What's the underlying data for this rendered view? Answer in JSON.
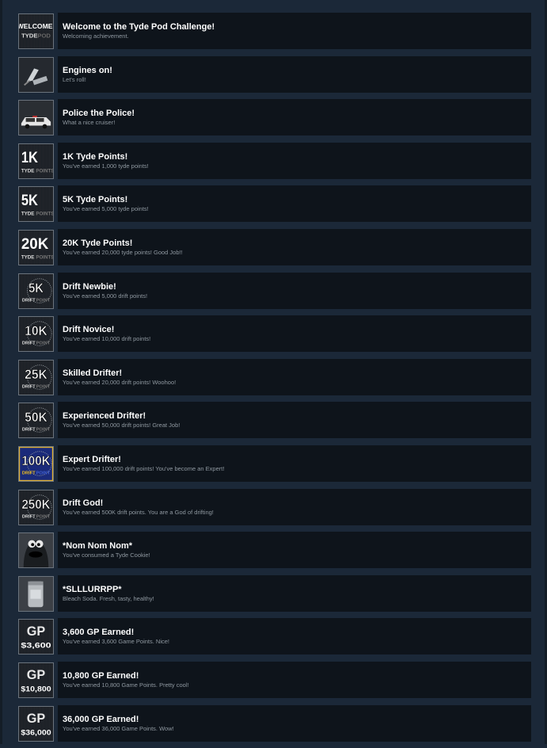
{
  "achievements": [
    {
      "title": "Welcome to the Tyde Pod Challenge!",
      "description": "Welcoming achievement.",
      "icon": "welcome-icon",
      "icon_line1": "WELCOME!",
      "icon_line2": "TYDE",
      "icon_line2b": "POD"
    },
    {
      "title": "Engines on!",
      "description": "Let's roll!",
      "icon": "car-seat-icon"
    },
    {
      "title": "Police the Police!",
      "description": "What a nice cruiser!",
      "icon": "police-car-icon"
    },
    {
      "title": "1K Tyde Points!",
      "description": "You've earned 1,000 tyde points!",
      "icon": "tyde-points-icon",
      "icon_line1": "1K",
      "icon_line2": "TYDE",
      "icon_line2b": "POINTS"
    },
    {
      "title": "5K Tyde Points!",
      "description": "You've earned 5,000 tyde points!",
      "icon": "tyde-points-icon",
      "icon_line1": "5K",
      "icon_line2": "TYDE",
      "icon_line2b": "POINTS"
    },
    {
      "title": "20K Tyde Points!",
      "description": "You've earned 20,000 tyde points! Good Job!!",
      "icon": "tyde-points-icon",
      "icon_line1": "20K",
      "icon_line2": "TYDE",
      "icon_line2b": "POINTS"
    },
    {
      "title": "Drift Newbie!",
      "description": "You've earned 5,000 drift points!",
      "icon": "drift-points-icon",
      "icon_line1": "5K",
      "icon_line2": "DRIFT",
      "icon_line2b": "POINT"
    },
    {
      "title": "Drift Novice!",
      "description": "You've earned 10,000 drift points!",
      "icon": "drift-points-icon",
      "icon_line1": "10K",
      "icon_line2": "DRIFT",
      "icon_line2b": "POINT"
    },
    {
      "title": "Skilled Drifter!",
      "description": "You've earned 20,000 drift points! Woohoo!",
      "icon": "drift-points-icon",
      "icon_line1": "25K",
      "icon_line2": "DRIFT",
      "icon_line2b": "POINT"
    },
    {
      "title": "Experienced Drifter!",
      "description": "You've earned 50,000 drift points! Great Job!",
      "icon": "drift-points-icon",
      "icon_line1": "50K",
      "icon_line2": "DRIFT",
      "icon_line2b": "POINT"
    },
    {
      "title": "Expert Drifter!",
      "description": "You've earned 100,000 drift points! You've become an Expert!",
      "icon": "drift-points-icon-gold",
      "icon_line1": "100K",
      "icon_line2": "DRIFT",
      "icon_line2b": "POINT"
    },
    {
      "title": "Drift God!",
      "description": "You've earned 500K drift points. You are a God of drifting!",
      "icon": "drift-points-icon",
      "icon_line1": "250K",
      "icon_line2": "DRIFT",
      "icon_line2b": "POINT"
    },
    {
      "title": "*Nom Nom Nom*",
      "description": "You've consumed a Tyde Cookie!",
      "icon": "cookie-monster-icon"
    },
    {
      "title": "*SLLLURRPP*",
      "description": "Bleach Soda. Fresh, tasty, healthy!",
      "icon": "soda-can-icon"
    },
    {
      "title": "3,600 GP Earned!",
      "description": "You've earned 3,600 Game Points. Nice!",
      "icon": "game-points-icon",
      "icon_line1": "GP",
      "icon_line2": "$3,600"
    },
    {
      "title": "10,800 GP Earned!",
      "description": "You've earned 10,800 Game Points. Pretty cool!",
      "icon": "game-points-icon",
      "icon_line1": "GP",
      "icon_line2": "$10,800"
    },
    {
      "title": "36,000 GP Earned!",
      "description": "You've earned 36,000 Game Points. Wow!",
      "icon": "game-points-icon",
      "icon_line1": "GP",
      "icon_line2": "$36,000"
    }
  ]
}
